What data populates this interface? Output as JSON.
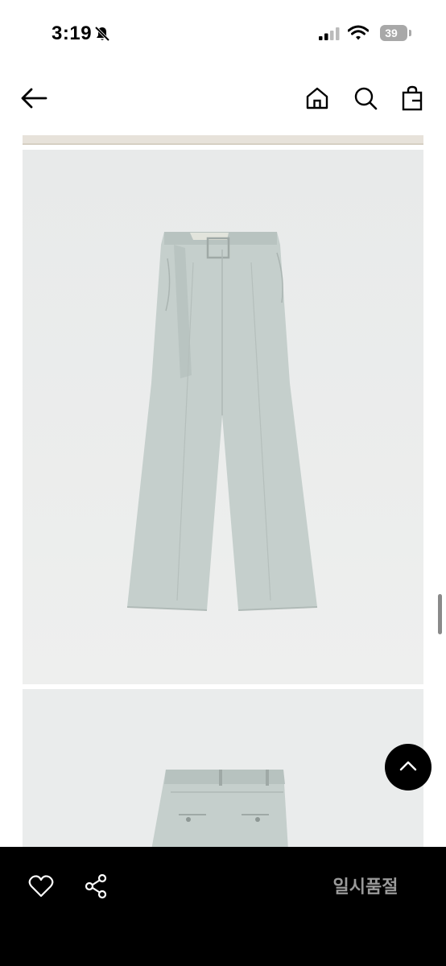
{
  "status_bar": {
    "time": "3:19",
    "battery": "39",
    "icons": [
      "bell-slash-icon",
      "signal-icon",
      "wifi-icon",
      "battery-icon"
    ]
  },
  "nav": {
    "icons": [
      "back-arrow-icon",
      "home-icon",
      "search-icon",
      "shopping-bag-icon"
    ]
  },
  "product_images": [
    {
      "subject": "pants-front-view"
    },
    {
      "subject": "pants-back-view"
    }
  ],
  "scroll_top": {
    "icon": "chevron-up-icon"
  },
  "bottom_bar": {
    "wishlist_icon": "heart-icon",
    "share_icon": "share-icon",
    "status_label": "일시품절"
  },
  "colors": {
    "bottom_bar": "#000000",
    "status_label": "#9a9a9a",
    "product_fabric": "#c5cfcc",
    "image_background": "#e9ebeb"
  }
}
